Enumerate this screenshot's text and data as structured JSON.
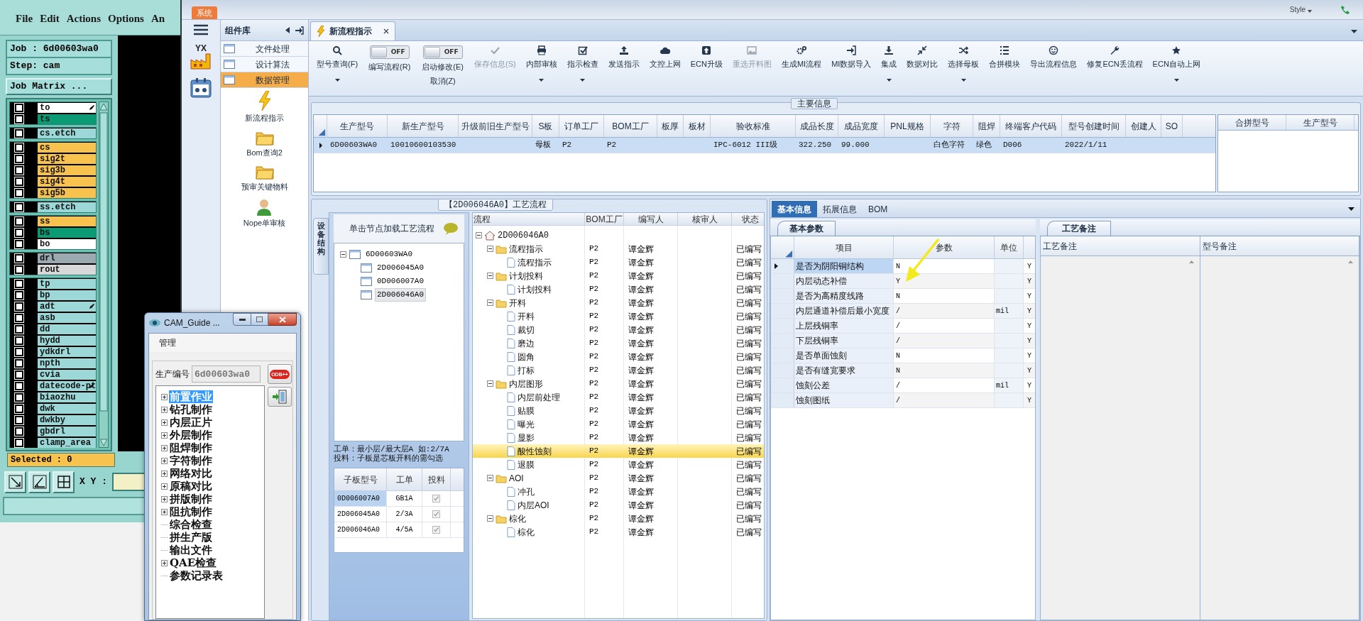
{
  "genesis": {
    "menu": [
      "File",
      "Edit",
      "Actions",
      "Options",
      "An"
    ],
    "job": "Job : 6d00603wa0",
    "step": "Step: cam",
    "matrix_button": "Job Matrix ...",
    "layer_groups": [
      [
        {
          "name": "to",
          "color": "#ffffff",
          "checked": false,
          "modified": true
        },
        {
          "name": "ts",
          "color": "#0b9b74",
          "checked": false,
          "modified": false
        }
      ],
      [
        {
          "name": "cs.etch",
          "color": "#9cd8d8",
          "checked": false,
          "modified": false
        }
      ],
      [
        {
          "name": "cs",
          "color": "#f8c24f",
          "checked": false,
          "modified": false
        },
        {
          "name": "sig2t",
          "color": "#f8c24f",
          "checked": false,
          "modified": false
        },
        {
          "name": "sig3b",
          "color": "#f8c24f",
          "checked": false,
          "modified": false
        },
        {
          "name": "sig4t",
          "color": "#f8c24f",
          "checked": false,
          "modified": false
        },
        {
          "name": "sig5b",
          "color": "#f8c24f",
          "checked": false,
          "modified": false
        }
      ],
      [
        {
          "name": "ss.etch",
          "color": "#9cd8d8",
          "checked": false,
          "modified": false
        }
      ],
      [
        {
          "name": "ss",
          "color": "#f8c24f",
          "checked": false,
          "modified": false
        },
        {
          "name": "bs",
          "color": "#0b9b74",
          "checked": false,
          "modified": false
        },
        {
          "name": "bo",
          "color": "#ffffff",
          "checked": false,
          "modified": false
        }
      ],
      [
        {
          "name": "drl",
          "color": "#9aaab0",
          "checked": false,
          "modified": false
        },
        {
          "name": "rout",
          "color": "#d8d8d8",
          "checked": false,
          "modified": false
        }
      ],
      [
        {
          "name": "tp",
          "color": "#9cd8d8",
          "checked": false,
          "modified": false
        },
        {
          "name": "bp",
          "color": "#9cd8d8",
          "checked": false,
          "modified": false
        },
        {
          "name": "adt",
          "color": "#9cd8d8",
          "checked": false,
          "modified": true
        },
        {
          "name": "asb",
          "color": "#9cd8d8",
          "checked": false,
          "modified": false
        },
        {
          "name": "dd",
          "color": "#9cd8d8",
          "checked": false,
          "modified": false
        },
        {
          "name": "hydd",
          "color": "#9cd8d8",
          "checked": false,
          "modified": false
        },
        {
          "name": "ydkdrl",
          "color": "#9cd8d8",
          "checked": false,
          "modified": false
        },
        {
          "name": "npth",
          "color": "#9cd8d8",
          "checked": false,
          "modified": false
        },
        {
          "name": "cvia",
          "color": "#9cd8d8",
          "checked": false,
          "modified": false
        },
        {
          "name": "datecode-pt",
          "color": "#9cd8d8",
          "checked": false,
          "modified": true
        },
        {
          "name": "biaozhu",
          "color": "#9cd8d8",
          "checked": false,
          "modified": false
        },
        {
          "name": "dwk",
          "color": "#9cd8d8",
          "checked": false,
          "modified": false
        },
        {
          "name": "dwkby",
          "color": "#9cd8d8",
          "checked": false,
          "modified": false
        },
        {
          "name": "gbdrl",
          "color": "#9cd8d8",
          "checked": false,
          "modified": false
        },
        {
          "name": "clamp_area",
          "color": "#9cd8d8",
          "checked": false,
          "modified": false
        }
      ]
    ],
    "selected_count": "Selected : 0",
    "xy_label": "X Y :"
  },
  "app": {
    "system_tab": "系统",
    "style_label": "Style",
    "logo_text": "YX",
    "component_panel": {
      "title": "组件库",
      "categories": [
        {
          "label": "文件处理",
          "selected": false
        },
        {
          "label": "设计算法",
          "selected": false
        },
        {
          "label": "数据管理",
          "selected": true
        }
      ],
      "tools": [
        "新流程指示",
        "Bom查询2",
        "预审关键物料",
        "Nope单审核"
      ]
    },
    "tabs": [
      {
        "label": "新流程指示",
        "selected": true
      }
    ],
    "toolbar": [
      {
        "kind": "button",
        "label": "型号查询(F)",
        "caret": true,
        "disabled": false
      },
      {
        "kind": "toggle",
        "label": "编写流程(R)",
        "switch_text": "OFF",
        "on": false
      },
      {
        "kind": "toggle",
        "label": "启动修改(E)",
        "switch_text": "OFF",
        "on": false,
        "sub_label": "取消(Z)"
      },
      {
        "kind": "button",
        "label": "保存信息(S)",
        "caret": false,
        "disabled": true
      },
      {
        "kind": "button",
        "label": "内部审核",
        "caret": true,
        "disabled": false
      },
      {
        "kind": "button",
        "label": "指示检查",
        "caret": true,
        "disabled": false
      },
      {
        "kind": "button",
        "label": "发送指示",
        "caret": false,
        "disabled": false
      },
      {
        "kind": "button",
        "label": "文控上网",
        "caret": false,
        "disabled": false
      },
      {
        "kind": "button",
        "label": "ECN升级",
        "caret": false,
        "disabled": false
      },
      {
        "kind": "button",
        "label": "重选开料图",
        "caret": false,
        "disabled": true
      },
      {
        "kind": "button",
        "label": "生成MI流程",
        "caret": false,
        "disabled": false
      },
      {
        "kind": "button",
        "label": "MI数据导入",
        "caret": false,
        "disabled": false
      },
      {
        "kind": "button",
        "label": "集成",
        "caret": true,
        "disabled": false
      },
      {
        "kind": "button",
        "label": "数据对比",
        "caret": false,
        "disabled": false
      },
      {
        "kind": "button",
        "label": "选择母板",
        "caret": true,
        "disabled": false
      },
      {
        "kind": "button",
        "label": "合拼模块",
        "caret": false,
        "disabled": false
      },
      {
        "kind": "button",
        "label": "导出流程信息",
        "caret": false,
        "disabled": false
      },
      {
        "kind": "button",
        "label": "修复ECN丢流程",
        "caret": false,
        "disabled": false
      },
      {
        "kind": "button",
        "label": "ECN自动上网",
        "caret": true,
        "disabled": false
      }
    ],
    "main_info": {
      "title": "主要信息",
      "columns": [
        "生产型号",
        "新生产型号",
        "升级前旧生产型号",
        "S板",
        "订单工厂",
        "BOM工厂",
        "板厚",
        "板材",
        "验收标准",
        "成品长度",
        "成品宽度",
        "PNL规格",
        "字符",
        "阻焊",
        "终端客户代码",
        "型号创建时间",
        "创建人",
        "SO"
      ],
      "rows": [
        {
          "selected": true,
          "cells": [
            "6D00603WA0",
            "10010600103530",
            null,
            "母板",
            "P2",
            "P2",
            null,
            null,
            "IPC-6012 III级",
            "322.250",
            "99.000",
            null,
            "白色字符",
            "绿色",
            "D006",
            "2022/1/11",
            null,
            null
          ]
        }
      ],
      "merge_columns": [
        "合拼型号",
        "生产型号"
      ]
    },
    "process": {
      "title": "【2D006046A0】工艺流程",
      "side_tab": "设备结构",
      "hint": "单击节点加载工艺流程",
      "boards": {
        "label": "6D00603WA0",
        "expanded": true,
        "selected": false,
        "children": [
          {
            "label": "2D006045A0",
            "selected": false
          },
          {
            "label": "0D006007A0",
            "selected": false
          },
          {
            "label": "2D006046A0",
            "selected": true
          }
        ]
      },
      "notes": [
        "工单：最小层/最大层A 如:2/7A",
        "投料：子板是芯板开料的需勾选"
      ],
      "sub_columns": [
        "子板型号",
        "工单",
        "投料"
      ],
      "sub_rows": [
        {
          "model": "0D006007A0",
          "order": "GB1A",
          "fed": true,
          "selected": true
        },
        {
          "model": "2D006045A0",
          "order": "2/3A",
          "fed": true,
          "selected": false
        },
        {
          "model": "2D006046A0",
          "order": "4/5A",
          "fed": true,
          "selected": false
        }
      ],
      "columns": [
        "流程",
        "BOM工厂",
        "编写人",
        "核审人",
        "状态"
      ],
      "root": {
        "label": "2D006046A0",
        "expanded": true,
        "selected": false,
        "children": [
          {
            "label": "流程指示",
            "bom": "P2",
            "writer": "谭金辉",
            "status": "已编写",
            "expanded": true,
            "selected": false,
            "children": [
              {
                "label": "流程指示",
                "bom": "P2",
                "writer": "谭金辉",
                "status": "已编写",
                "selected": false
              }
            ]
          },
          {
            "label": "计划投料",
            "bom": "P2",
            "writer": "谭金辉",
            "status": "已编写",
            "expanded": true,
            "selected": false,
            "children": [
              {
                "label": "计划投料",
                "bom": "P2",
                "writer": "谭金辉",
                "status": "已编写",
                "selected": false
              }
            ]
          },
          {
            "label": "开料",
            "bom": "P2",
            "writer": "谭金辉",
            "status": "已编写",
            "expanded": true,
            "selected": false,
            "children": [
              {
                "label": "开料",
                "bom": "P2",
                "writer": "谭金辉",
                "status": "已编写",
                "selected": false
              },
              {
                "label": "裁切",
                "bom": "P2",
                "writer": "谭金辉",
                "status": "已编写",
                "selected": false
              },
              {
                "label": "磨边",
                "bom": "P2",
                "writer": "谭金辉",
                "status": "已编写",
                "selected": false
              },
              {
                "label": "圆角",
                "bom": "P2",
                "writer": "谭金辉",
                "status": "已编写",
                "selected": false
              },
              {
                "label": "打标",
                "bom": "P2",
                "writer": "谭金辉",
                "status": "已编写",
                "selected": false
              }
            ]
          },
          {
            "label": "内层图形",
            "bom": "P2",
            "writer": "谭金辉",
            "status": "已编写",
            "expanded": true,
            "selected": false,
            "children": [
              {
                "label": "内层前处理",
                "bom": "P2",
                "writer": "谭金辉",
                "status": "已编写",
                "selected": false
              },
              {
                "label": "贴膜",
                "bom": "P2",
                "writer": "谭金辉",
                "status": "已编写",
                "selected": false
              },
              {
                "label": "曝光",
                "bom": "P2",
                "writer": "谭金辉",
                "status": "已编写",
                "selected": false
              },
              {
                "label": "显影",
                "bom": "P2",
                "writer": "谭金辉",
                "status": "已编写",
                "selected": false
              },
              {
                "label": "酸性蚀刻",
                "bom": "P2",
                "writer": "谭金辉",
                "status": "已编写",
                "selected": true
              },
              {
                "label": "退膜",
                "bom": "P2",
                "writer": "谭金辉",
                "status": "已编写",
                "selected": false
              }
            ]
          },
          {
            "label": "AOI",
            "bom": "P2",
            "writer": "谭金辉",
            "status": "已编写",
            "expanded": true,
            "selected": false,
            "children": [
              {
                "label": "冲孔",
                "bom": "P2",
                "writer": "谭金辉",
                "status": "已编写",
                "selected": false
              },
              {
                "label": "内层AOI",
                "bom": "P2",
                "writer": "谭金辉",
                "status": "已编写",
                "selected": false
              }
            ]
          },
          {
            "label": "棕化",
            "bom": "P2",
            "writer": "谭金辉",
            "status": "已编写",
            "expanded": true,
            "selected": false,
            "children": [
              {
                "label": "棕化",
                "bom": "P2",
                "writer": "谭金辉",
                "status": "已编写",
                "selected": false
              }
            ]
          }
        ]
      }
    },
    "detail": {
      "tabs": [
        {
          "label": "基本信息",
          "selected": true
        },
        {
          "label": "拓展信息",
          "selected": false
        },
        {
          "label": "BOM",
          "selected": false
        }
      ],
      "param_tab": "基本参数",
      "param_columns": [
        "项目",
        "参数",
        "单位"
      ],
      "params": [
        {
          "item": "是否为阴阳铜结构",
          "value": "N",
          "flag": "Y",
          "selected": true
        },
        {
          "item": "内层动态补偿",
          "value": "Y",
          "flag": "Y",
          "selected": false
        },
        {
          "item": "是否为高精度线路",
          "value": "N",
          "flag": "Y",
          "selected": false
        },
        {
          "item": "内层通道补偿后最小宽度",
          "value": "/",
          "unit": "mil",
          "flag": "Y",
          "selected": false
        },
        {
          "item": "上层残铜率",
          "value": "/",
          "flag": "Y",
          "selected": false
        },
        {
          "item": "下层残铜率",
          "value": "/",
          "flag": "Y",
          "selected": false
        },
        {
          "item": "是否单面蚀刻",
          "value": "N",
          "flag": "Y",
          "selected": false
        },
        {
          "item": "是否有缝宽要求",
          "value": "N",
          "flag": "Y",
          "selected": false
        },
        {
          "item": "蚀刻公差",
          "value": "/",
          "unit": "mil",
          "flag": "Y",
          "selected": false
        },
        {
          "item": "蚀刻图纸",
          "value": "/",
          "flag": "Y",
          "selected": false
        }
      ],
      "remark_tab": "工艺备注",
      "remark_columns": [
        "工艺备注",
        "型号备注"
      ]
    }
  },
  "cam_guide": {
    "title": "CAM_Guide ...",
    "menu": [
      "管理"
    ],
    "field_label": "生产编号",
    "field_value": "6d00603wa0",
    "odb_label": "ODB++",
    "steps": [
      {
        "label": "前置作业",
        "expandable": true,
        "selected": true
      },
      {
        "label": "钻孔制作",
        "expandable": true,
        "selected": false
      },
      {
        "label": "内层正片",
        "expandable": true,
        "selected": false
      },
      {
        "label": "外层制作",
        "expandable": true,
        "selected": false
      },
      {
        "label": "阻焊制作",
        "expandable": true,
        "selected": false
      },
      {
        "label": "字符制作",
        "expandable": true,
        "selected": false
      },
      {
        "label": "网络对比",
        "expandable": true,
        "selected": false
      },
      {
        "label": "原稿对比",
        "expandable": true,
        "selected": false
      },
      {
        "label": "拼版制作",
        "expandable": true,
        "selected": false
      },
      {
        "label": "阻抗制作",
        "expandable": true,
        "selected": false
      },
      {
        "label": "综合检查",
        "expandable": false,
        "selected": false
      },
      {
        "label": "拼生产版",
        "expandable": false,
        "selected": false
      },
      {
        "label": "输出文件",
        "expandable": false,
        "selected": false
      },
      {
        "label": "QAE检查",
        "expandable": true,
        "selected": false
      },
      {
        "label": "参数记录表",
        "expandable": false,
        "selected": false
      }
    ]
  }
}
